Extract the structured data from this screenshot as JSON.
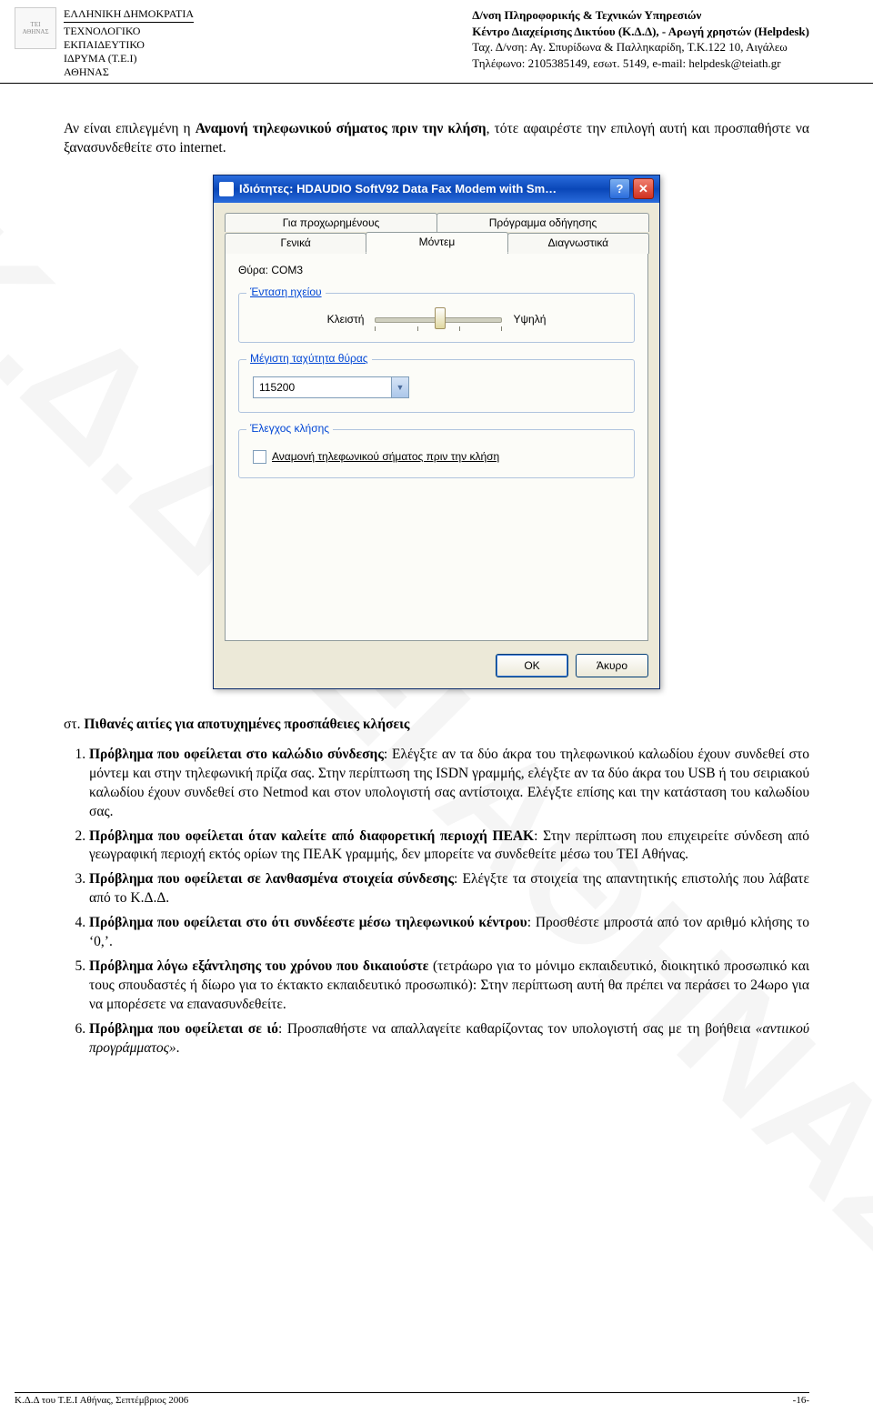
{
  "header": {
    "org_line1": "ΕΛΛΗΝΙΚΗ ΔΗΜΟΚΡΑΤΙΑ",
    "org_line2": "ΤΕΧΝΟΛΟΓΙΚΟ",
    "org_line3": "ΕΚΠΑΙΔΕΥΤΙΚΟ",
    "org_line4": "ΙΔΡΥΜΑ (Τ.Ε.Ι)",
    "org_line5": "ΑΘΗΝΑΣ",
    "right_line1": "Δ/νση Πληροφορικής & Τεχνικών Υπηρεσιών",
    "right_line2": "Κέντρο Διαχείρισης Δικτύου (Κ.Δ.Δ), - Αρωγή χρηστών (Helpdesk)",
    "right_line3": "Ταχ. Δ/νση: Αγ. Σπυρίδωνα & Παλληκαρίδη, Τ.Κ.122 10, Αιγάλεω",
    "right_line4": "Τηλέφωνο: 2105385149, εσωτ. 5149, e-mail: helpdesk@teiath.gr"
  },
  "intro": {
    "before": "Αν είναι επιλεγμένη η ",
    "bold": "Αναμονή τηλεφωνικού σήματος πριν την κλήση",
    "after": ", τότε αφαιρέστε την επιλογή αυτή και προσπαθήστε να ξανασυνδεθείτε στο internet."
  },
  "dialog": {
    "title": "Ιδιότητες: HDAUDIO SoftV92 Data Fax Modem with Sm…",
    "tabs_row1": [
      "Για προχωρημένους",
      "Πρόγραμμα οδήγησης"
    ],
    "tabs_row2": [
      "Γενικά",
      "Μόντεμ",
      "Διαγνωστικά"
    ],
    "port_label": "Θύρα: ",
    "port_value": "COM3",
    "group1": "Ένταση ηχείου",
    "slider_low": "Κλειστή",
    "slider_high": "Υψηλή",
    "group2": "Μέγιστη ταχύτητα θύρας",
    "speed_value": "115200",
    "group3": "Έλεγχος κλήσης",
    "check_label": "Αναμονή τηλεφωνικού σήματος πριν την κλήση",
    "ok": "OK",
    "cancel": "Άκυρο"
  },
  "section_title_prefix": "στ.",
  "section_title": "Πιθανές αιτίες για αποτυχημένες προσπάθειες κλήσεις",
  "problems": [
    {
      "lead": "Πρόβλημα που οφείλεται στο καλώδιο σύνδεσης",
      "rest": ": Ελέγξτε αν τα δύο άκρα του τηλεφωνικού καλωδίου έχουν συνδεθεί στο μόντεμ και στην τηλεφωνική πρίζα σας. Στην περίπτωση της ISDN γραμμής, ελέγξτε αν τα δύο άκρα του USB ή του σειριακού καλωδίου έχουν συνδεθεί στο Netmod και στον υπολογιστή σας αντίστοιχα. Ελέγξτε επίσης και την κατάσταση του καλωδίου σας."
    },
    {
      "lead": "Πρόβλημα που οφείλεται όταν καλείτε από διαφορετική περιοχή ΠΕΑΚ",
      "rest": ": Στην περίπτωση που επιχειρείτε σύνδεση από γεωγραφική περιοχή εκτός ορίων της ΠΕΑΚ γραμμής, δεν μπορείτε να συνδεθείτε μέσω του ΤΕΙ Αθήνας."
    },
    {
      "lead": "Πρόβλημα που οφείλεται σε λανθασμένα στοιχεία σύνδεσης",
      "rest": ": Ελέγξτε τα στοιχεία της απαντητικής επιστολής που λάβατε από το Κ.Δ.Δ."
    },
    {
      "lead": "Πρόβλημα που οφείλεται στο ότι συνδέεστε μέσω τηλεφωνικού κέντρου",
      "rest": ": Προσθέστε μπροστά από τον αριθμό κλήσης το ‘0,’."
    },
    {
      "lead": "Πρόβλημα λόγω εξάντλησης του χρόνου που δικαιούστε",
      "rest": " (τετράωρο για το μόνιμο εκπαιδευτικό, διοικητικό προσωπικό και τους σπουδαστές ή δίωρο για το έκτακτο εκπαιδευτικό προσωπικό): Στην περίπτωση αυτή θα πρέπει να περάσει το 24ωρο για να μπορέσετε να επανασυνδεθείτε."
    },
    {
      "lead": "Πρόβλημα που οφείλεται σε ιό",
      "rest": ": Προσπαθήστε να απαλλαγείτε καθαρίζοντας τον υπολογιστή σας με τη βοήθεια ",
      "italic": "«αντιικού προγράμματος»",
      "tail": "."
    }
  ],
  "footer": {
    "left": "Κ.Δ.Δ του Τ.Ε.Ι Αθήνας, Σεπτέμβριος 2006",
    "right": "-16-"
  },
  "watermark": "Κ.Δ.Δ ΤΕΙ ΑΘΗΝΑΣ"
}
